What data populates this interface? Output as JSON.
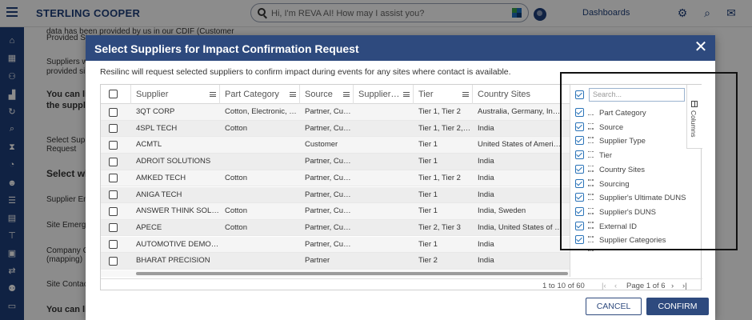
{
  "app": {
    "brand": "STERLING COOPER",
    "search_placeholder": "Hi, I'm REVA AI! How may I assist you?",
    "dashboards_label": "Dashboards"
  },
  "background": {
    "lines": [
      "data has been provided by us in our CDIF (Customer",
      "Provided Si",
      "Suppliers w",
      "provided si",
      "You can li",
      "the supplie",
      "Select Supp",
      "Request",
      "Select wh",
      "Supplier Em",
      "Site Emerge",
      "Company C",
      "(mapping)",
      "Site Contac",
      "You can lin"
    ]
  },
  "modal": {
    "title": "Select Suppliers for Impact Confirmation Request",
    "description": "Resilinc will request selected suppliers to confirm impact during events for any sites where contact is available.",
    "columns": [
      "Supplier",
      "Part Category",
      "Source",
      "Supplier…",
      "Tier",
      "Country Sites"
    ],
    "rows": [
      [
        "3QT CORP",
        "Cotton, Electronic, …",
        "Partner, Cust…",
        "",
        "Tier 1, Tier 2",
        "Australia, Germany, In…"
      ],
      [
        "4SPL TECH",
        "Cotton",
        "Partner, Cust…",
        "",
        "Tier 1, Tier 2,…",
        "India"
      ],
      [
        "ACMTL",
        "",
        "Customer",
        "",
        "Tier 1",
        "United States of Ameri…"
      ],
      [
        "ADROIT SOLUTIONS",
        "",
        "Partner, Cust…",
        "",
        "Tier 1",
        "India"
      ],
      [
        "AMKED TECH",
        "Cotton",
        "Partner, Cust…",
        "",
        "Tier 1, Tier 2",
        "India"
      ],
      [
        "ANIGA TECH",
        "",
        "Partner, Cust…",
        "",
        "Tier 1",
        "India"
      ],
      [
        "ANSWER THINK SOLU…",
        "Cotton",
        "Partner, Cust…",
        "",
        "Tier 1",
        "India, Sweden"
      ],
      [
        "APECE",
        "Cotton",
        "Partner, Cust…",
        "",
        "Tier 2, Tier 3",
        "India, United States of …"
      ],
      [
        "AUTOMOTIVE DEMO …",
        "",
        "Partner, Cust…",
        "",
        "Tier 1",
        "India"
      ],
      [
        "BHARAT PRECISION",
        "",
        "Partner",
        "",
        "Tier 2",
        "India"
      ]
    ],
    "columns_panel": {
      "search_placeholder": "Search...",
      "tab_label": "Columns",
      "items": [
        "Part Category",
        "Source",
        "Supplier Type",
        "Tier",
        "Country Sites",
        "Sourcing",
        "Supplier's Ultimate DUNS",
        "Supplier's DUNS",
        "External ID",
        "Supplier Categories"
      ]
    },
    "pager": {
      "range": "1 to 10 of 60",
      "page": "Page 1 of 6"
    },
    "cancel_label": "CANCEL",
    "confirm_label": "CONFIRM"
  },
  "colors": {
    "brand_blue": "#1e3f7a",
    "header_blue": "#2e4a7e",
    "checkbox_blue": "#2a73b8"
  }
}
